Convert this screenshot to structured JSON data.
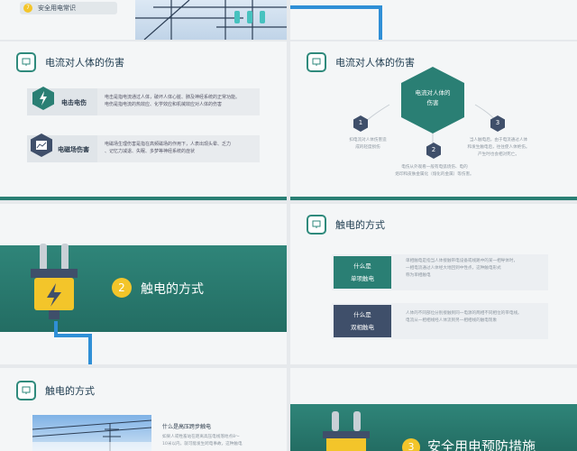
{
  "slides": {
    "s1": {
      "num": "7",
      "text": "安全用电常识"
    },
    "s2": {
      "title": "电流对人体的伤害",
      "card1": {
        "label": "电击电伤",
        "lines": [
          "电击是指电流通过人体，破坏人体心脏、肺及神经系统的正常功能。",
          "电伤是指电流的热效应、化学效应和机械效应对人体的伤害"
        ]
      },
      "card2": {
        "label": "电磁场伤害",
        "lines": [
          "电磁场生理伤害是指在高频磁场的作用下，人表出现头晕、乏力",
          "、记忆力减退、失眠、多梦等神经系统的症状"
        ]
      }
    },
    "s3": {
      "title": "电流对人体的伤害",
      "hex_line1": "电流对人体的",
      "hex_line2": "伤害",
      "n1": "1",
      "n2": "2",
      "n3": "3",
      "t1_line1": "扣电流对人体伤害造",
      "t1_line2": "成的轻度损伤",
      "t2_line1": "电伤从外观看一般有电弧烧伤、电的",
      "t2_line2": "烙印和皮肤金属化（熔化的金属）等伤害。",
      "t3_line1": "当人触电后，由于电流通过人体",
      "t3_line2": "和发生触电后，往往使人体绝伤。",
      "t3_line3": "产生时也会相对死亡。"
    },
    "s4": {
      "num": "2",
      "title": "触电的方式"
    },
    "s5": {
      "title": "触电的方式",
      "box1_line1": "什么是",
      "box1_line2": "单项触电",
      "box1_text": [
        "单相触电是指当人体接触带电设备或线路中的某一相导体时，",
        "一相电流通过人体经大地回到中性点，这种触电形式",
        "称为单相触电"
      ],
      "box2_line1": "什么是",
      "box2_line2": "双相触电",
      "box2_text": [
        "人体的不同部位分别接触到同一电源的两相不同相位的带电线。",
        "电流从一相相线经人体流到另一相相线的触电现象"
      ]
    },
    "s6": {
      "title": "触电的方式",
      "heading": "什么是高压跨步触电",
      "lines": [
        "如果人或牲畜站在距离高压电线落地点8～",
        "10米以内，就可能发生跨电事故，这种触电"
      ]
    },
    "s7": {
      "num": "3",
      "title": "安全用电预防措施"
    }
  },
  "colors": {
    "teal": "#2a7f74",
    "navy": "#3f4f6a",
    "yellow": "#f3c52a",
    "blue_cable": "#2f8fd6"
  },
  "icons": [
    "presentation-icon",
    "lightning-icon",
    "chart-hand-icon",
    "plug-icon"
  ]
}
